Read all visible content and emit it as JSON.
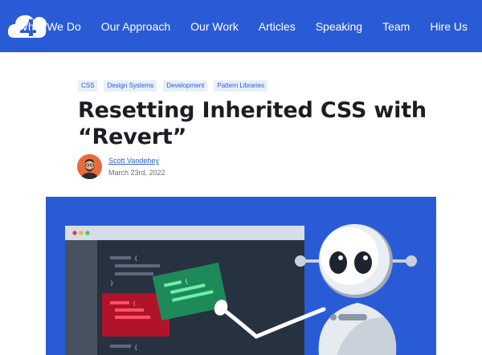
{
  "nav": {
    "logo": "4",
    "links": [
      "What We Do",
      "Our Approach",
      "Our Work",
      "Articles",
      "Speaking",
      "Team",
      "Hire Us"
    ]
  },
  "article": {
    "tags": [
      "CSS",
      "Design Systems",
      "Development",
      "Pattern Libraries"
    ],
    "title": "Resetting Inherited CSS with “Revert”",
    "author": "Scott Vandehey",
    "date": "March 23rd, 2022"
  },
  "hero": {
    "code_braces": [
      "{",
      "}",
      "{",
      "}",
      "{",
      "{"
    ]
  },
  "colors": {
    "brand_blue": "#2a5bd7",
    "code_red": "#b0142a",
    "code_green": "#1e8a5a",
    "tag_bg": "#e7effb"
  }
}
